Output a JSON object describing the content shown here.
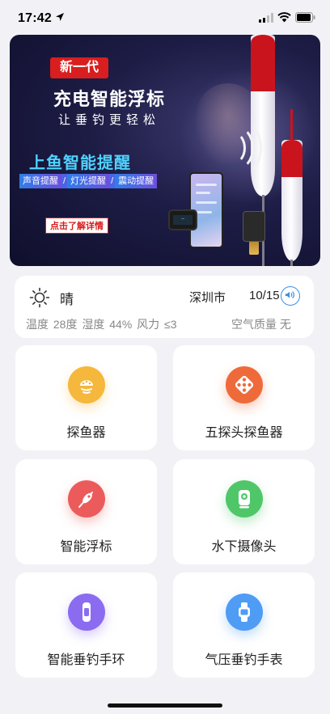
{
  "status_bar": {
    "time": "17:42",
    "icons": [
      "location-arrow-icon",
      "cellular-signal-icon",
      "wifi-icon",
      "battery-icon"
    ]
  },
  "banner": {
    "badge": "新一代",
    "title": "充电智能浮标",
    "subtitle": "让垂钓更轻松",
    "headline": "上鱼智能提醒",
    "features": [
      "声音提醒",
      "灯光提醒",
      "震动提醒"
    ],
    "feature_separator": "/",
    "cta": "点击了解详情",
    "colors": {
      "badge": "#d81e1e",
      "headline": "#4fd3ff",
      "background": "#1d1c45"
    }
  },
  "weather": {
    "icon": "sun-icon",
    "condition": "晴",
    "city": "深圳市",
    "date": "10/15",
    "details": "温度 28度  湿度 44%  风力 ≤3",
    "air_quality": "空气质量 无",
    "speaker_icon": "speaker-icon",
    "accent": "#3b8de8"
  },
  "tiles": [
    {
      "label": "探鱼器",
      "icon": "fish-finder-icon",
      "color": "#f5b73c"
    },
    {
      "label": "五探头探鱼器",
      "icon": "five-probe-icon",
      "color": "#ef6a3a"
    },
    {
      "label": "智能浮标",
      "icon": "smart-float-icon",
      "color": "#ec5b5b"
    },
    {
      "label": "水下摄像头",
      "icon": "underwater-camera-icon",
      "color": "#4fc769"
    },
    {
      "label": "智能垂钓手环",
      "icon": "fishing-band-icon",
      "color": "#8b6cf0"
    },
    {
      "label": "气压垂钓手表",
      "icon": "pressure-watch-icon",
      "color": "#4f9cf5"
    }
  ]
}
